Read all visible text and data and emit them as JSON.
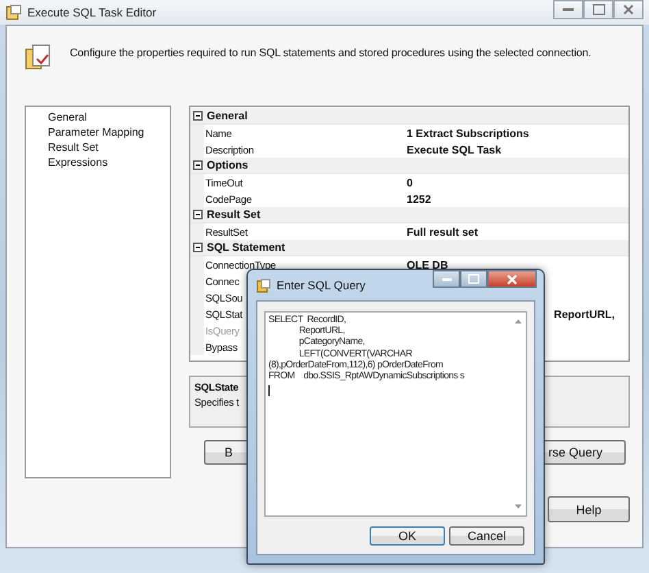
{
  "window": {
    "title": "Execute SQL Task Editor",
    "description": "Configure the properties required to run SQL statements and stored procedures using the selected connection."
  },
  "nav": [
    {
      "label": "General"
    },
    {
      "label": "Parameter Mapping"
    },
    {
      "label": "Result Set"
    },
    {
      "label": "Expressions"
    }
  ],
  "properties": [
    {
      "kind": "category",
      "label": "General",
      "expanded": true
    },
    {
      "kind": "property",
      "name": "Name",
      "value": "1 Extract Subscriptions",
      "disabled": false
    },
    {
      "kind": "property",
      "name": "Description",
      "value": "Execute SQL Task",
      "disabled": false
    },
    {
      "kind": "category",
      "label": "Options",
      "expanded": true
    },
    {
      "kind": "property",
      "name": "TimeOut",
      "value": "0",
      "disabled": false
    },
    {
      "kind": "property",
      "name": "CodePage",
      "value": "1252",
      "disabled": false
    },
    {
      "kind": "category",
      "label": "Result Set",
      "expanded": true
    },
    {
      "kind": "property",
      "name": "ResultSet",
      "value": "Full result set",
      "disabled": false
    },
    {
      "kind": "category",
      "label": "SQL Statement",
      "expanded": true
    },
    {
      "kind": "property",
      "name": "ConnectionType",
      "value": "OLE DB",
      "disabled": false
    },
    {
      "kind": "property",
      "name": "Connec",
      "disabled": false
    },
    {
      "kind": "property",
      "name": "SQLSou",
      "disabled": false
    },
    {
      "kind": "covered_property",
      "name": "SQLStat",
      "value": "ReportURL,",
      "disabled": false
    },
    {
      "kind": "property",
      "name": "IsQuery",
      "disabled": true
    },
    {
      "kind": "property",
      "name": "Bypass",
      "disabled": false
    }
  ],
  "description_panel": {
    "title": "SQLState",
    "text": "Specifies t"
  },
  "buttons": [
    {
      "label": "B",
      "kind": "left"
    },
    {
      "label": "rse Query",
      "kind": "right"
    }
  ],
  "help_button": "Help",
  "dialog": {
    "title": "Enter SQL Query",
    "query": "SELECT  RecordID,\n              ReportURL,\n              pCategoryName,\n              LEFT(CONVERT(VARCHAR\n(8),pOrderDateFrom,112),6) pOrderDateFrom\nFROM    dbo.SSIS_RptAWDynamicSubscriptions s",
    "buttons": [
      "OK",
      "Cancel"
    ]
  }
}
